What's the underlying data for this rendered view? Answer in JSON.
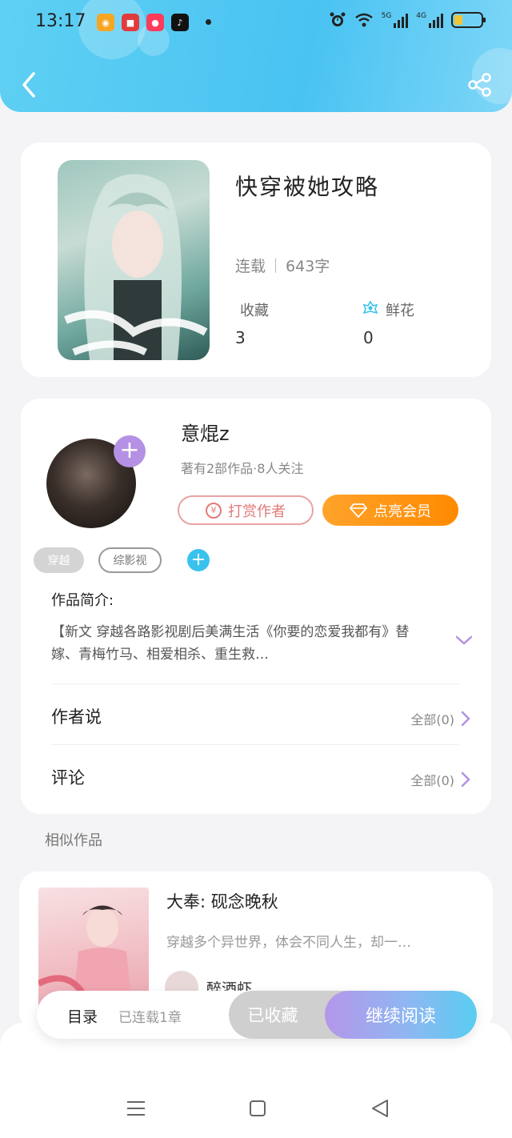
{
  "status_bar": {
    "time": "13:17",
    "app_badges": [
      {
        "name": "weibo-app-icon",
        "color": "#f5a623"
      },
      {
        "name": "store-app-icon",
        "color": "#e23a3a"
      },
      {
        "name": "shop-app-icon",
        "color": "#ff3b5c"
      },
      {
        "name": "tiktok-app-icon",
        "color": "#111111"
      }
    ],
    "signal_1_label": "5G",
    "signal_2_label": "4G",
    "battery_level": 0.3
  },
  "header": {
    "background_color": "#49c3f2"
  },
  "book": {
    "title": "快穿被她攻略",
    "status": "连载",
    "word_count": "643字",
    "collect_label": "收藏",
    "collect_count": "3",
    "flower_label": "鲜花",
    "flower_count": "0"
  },
  "author": {
    "name": "意焜z",
    "stats": "著有2部作品·8人关注",
    "tip_label": "打赏作者",
    "vip_label": "点亮会员",
    "tags": [
      "穿越",
      "综影视"
    ],
    "intro_label": "作品简介:",
    "intro_text": "【新文 穿越各路影视剧后美满生活《你要的恋爱我都有》替嫁、青梅竹马、相爱相杀、重生救…",
    "author_says_label": "作者说",
    "author_says_count": "全部(0)",
    "comments_label": "评论",
    "comments_count": "全部(0)"
  },
  "similar": {
    "section_title": "相似作品",
    "item": {
      "title": "大奉: 砚念晚秋",
      "description": "穿越多个异世界，体会不同人生，却一…",
      "author": "醉酒虾"
    }
  },
  "action_bar": {
    "toc_label": "目录",
    "toc_status": "已连载1章",
    "collected_label": "已收藏",
    "read_label": "继续阅读"
  },
  "colors": {
    "accent_blue": "#3ac2ee",
    "accent_purple": "#b491e4",
    "vip_orange": "#ff8a00"
  }
}
